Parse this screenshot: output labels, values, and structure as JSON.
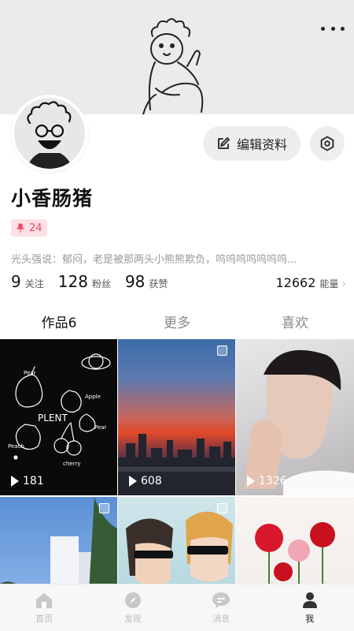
{
  "header": {
    "more_icon": "more-dots-icon"
  },
  "profile": {
    "username": "小香肠猪",
    "badge_value": "24",
    "bio": "光头强说：郁闷，老是被那两头小熊熊欺负，呜呜呜呜呜呜呜...",
    "edit_label": "编辑资料",
    "stats": [
      {
        "value": "9",
        "label": "关注"
      },
      {
        "value": "128",
        "label": "粉丝"
      },
      {
        "value": "98",
        "label": "获赞"
      }
    ],
    "energy": {
      "value": "12662",
      "label": "能量"
    }
  },
  "tabs": [
    {
      "label": "作品6"
    },
    {
      "label": "更多"
    },
    {
      "label": "喜欢"
    }
  ],
  "posts": [
    {
      "plays": "181",
      "theme": "doodle-fruits"
    },
    {
      "plays": "608",
      "theme": "sunset-city"
    },
    {
      "plays": "1326",
      "theme": "portrait"
    },
    {
      "plays": "",
      "theme": "buildings-sky"
    },
    {
      "plays": "",
      "theme": "anime-sunglasses"
    },
    {
      "plays": "",
      "theme": "roses"
    }
  ],
  "bottom_nav": [
    {
      "label": "首页",
      "icon": "home-icon"
    },
    {
      "label": "发现",
      "icon": "compass-icon"
    },
    {
      "label": "消息",
      "icon": "message-icon"
    },
    {
      "label": "我",
      "icon": "user-icon"
    }
  ],
  "colors": {
    "accent": "#f2455d",
    "badge_bg": "#fde0e5",
    "cover_bg": "#ebeaec"
  }
}
